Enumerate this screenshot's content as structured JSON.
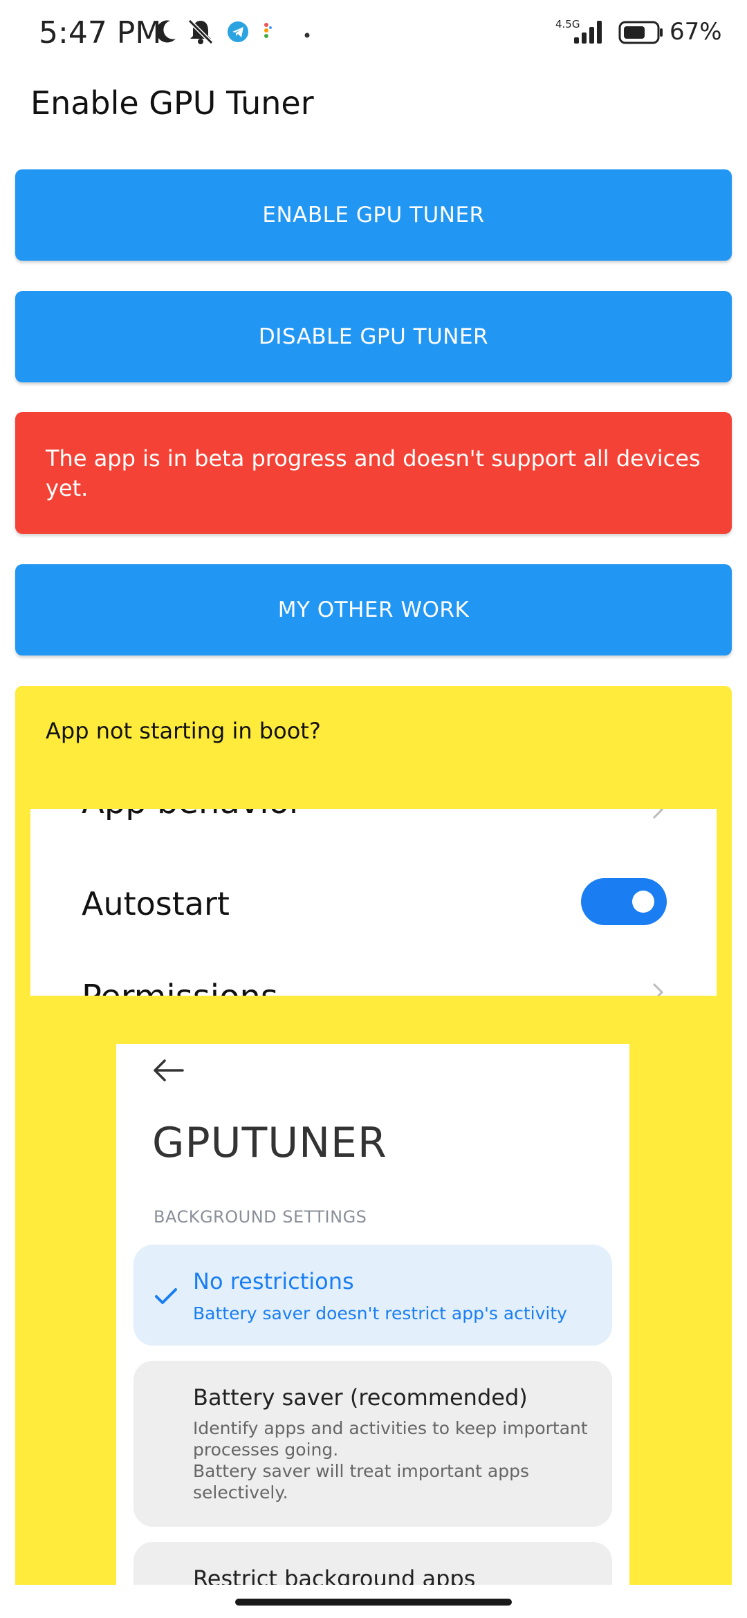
{
  "status_bar": {
    "time": "5:47 PM",
    "network": "4.5G",
    "battery_pct": "67%",
    "icons": [
      "moon-icon",
      "bell-off-icon",
      "telegram-icon",
      "app-dots-icon",
      "dot-icon",
      "signal-icon",
      "battery-icon"
    ]
  },
  "app": {
    "title": "Enable GPU Tuner"
  },
  "buttons": {
    "enable": "ENABLE GPU TUNER",
    "disable": "DISABLE GPU TUNER",
    "other_work": "MY OTHER WORK"
  },
  "warning": {
    "text": "The app is in beta progress and doesn't support all devices yet."
  },
  "boot_help": {
    "title": "App not starting in boot?",
    "screenshot1": {
      "top_row": "App behavior",
      "autostart_label": "Autostart",
      "autostart_on": true,
      "bottom_row": "Permissions"
    },
    "screenshot2": {
      "app_name": "GPUTUNER",
      "section": "BACKGROUND SETTINGS",
      "options": [
        {
          "title": "No restrictions",
          "desc": "Battery saver doesn't restrict app's activity",
          "selected": true
        },
        {
          "title": "Battery saver (recommended)",
          "desc": "Identify apps and activities to keep important processes going.\nBattery saver will treat important apps selectively.",
          "selected": false
        },
        {
          "title": "Restrict background apps",
          "desc": "",
          "selected": false
        }
      ]
    }
  },
  "colors": {
    "primary_blue": "#2196f3",
    "warning_red": "#f44336",
    "help_yellow": "#ffeb3b",
    "toggle_blue": "#1a7ef2"
  }
}
